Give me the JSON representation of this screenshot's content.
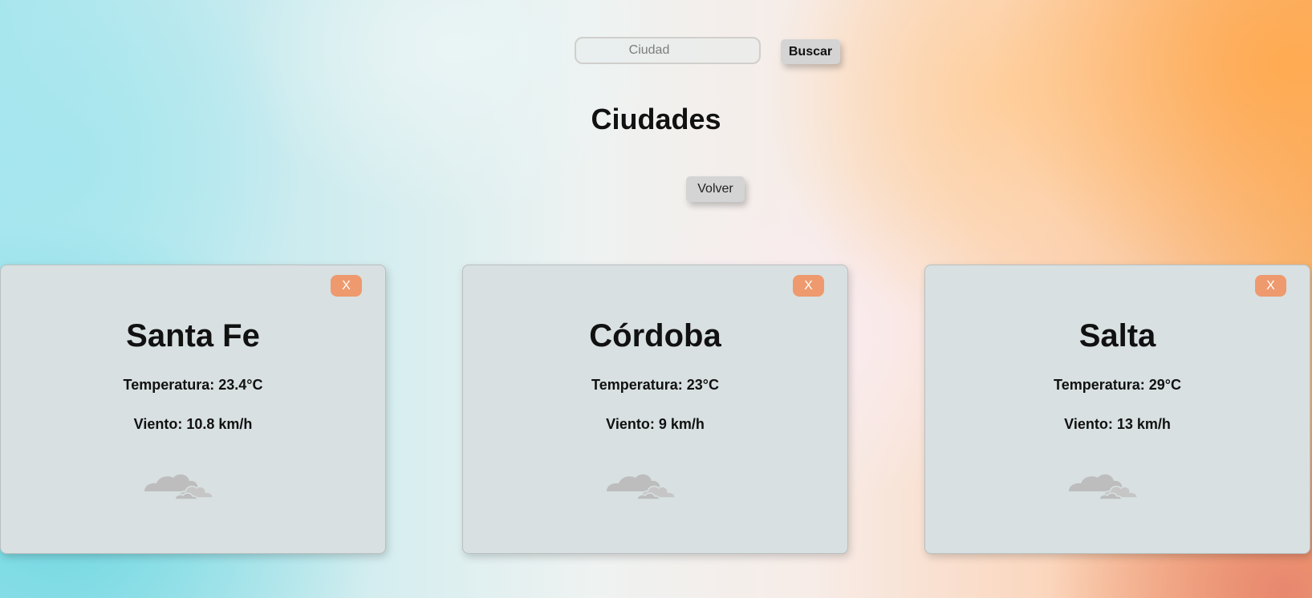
{
  "search": {
    "placeholder": "Ciudad",
    "button_label": "Buscar"
  },
  "header": {
    "title": "Ciudades",
    "back_label": "Volver"
  },
  "colors": {
    "card_bg": "#d8e0e1",
    "close_button": "#ee9a6e",
    "button_bg": "#d4d4d4"
  },
  "cards": [
    {
      "close_label": "X",
      "city": "Santa Fe",
      "temperature": "Temperatura: 23.4°C",
      "wind": "Viento: 10.8 km/h",
      "icon": "cloudy-icon"
    },
    {
      "close_label": "X",
      "city": "Córdoba",
      "temperature": "Temperatura: 23°C",
      "wind": "Viento: 9 km/h",
      "icon": "cloudy-icon"
    },
    {
      "close_label": "X",
      "city": "Salta",
      "temperature": "Temperatura: 29°C",
      "wind": "Viento: 13 km/h",
      "icon": "cloudy-icon"
    }
  ]
}
